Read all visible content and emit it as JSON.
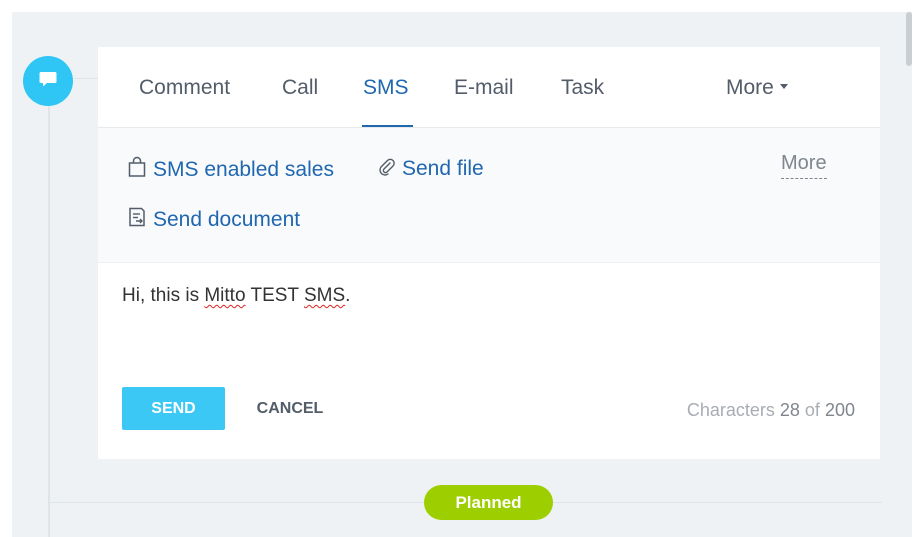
{
  "tabs": [
    {
      "label": "Comment"
    },
    {
      "label": "Call"
    },
    {
      "label": "SMS"
    },
    {
      "label": "E-mail"
    },
    {
      "label": "Task"
    },
    {
      "label": "More"
    }
  ],
  "active_tab": "SMS",
  "toolbar": {
    "sms_sales_label": "SMS enabled sales",
    "send_file_label": "Send file",
    "send_document_label": "Send document",
    "more_label": "More"
  },
  "message": {
    "part1": "Hi, this is ",
    "part2": "Mitto",
    "part3": " TEST ",
    "part4": "SMS",
    "part5": "."
  },
  "actions": {
    "send_label": "SEND",
    "cancel_label": "CANCEL"
  },
  "counter": {
    "prefix": "Characters",
    "current": "28",
    "of": "of",
    "max": "200"
  },
  "status_badge": "Planned",
  "colors": {
    "accent": "#2fc6f6",
    "link": "#2067b0",
    "send_button": "#3bc8f5",
    "badge": "#9dcf00"
  }
}
